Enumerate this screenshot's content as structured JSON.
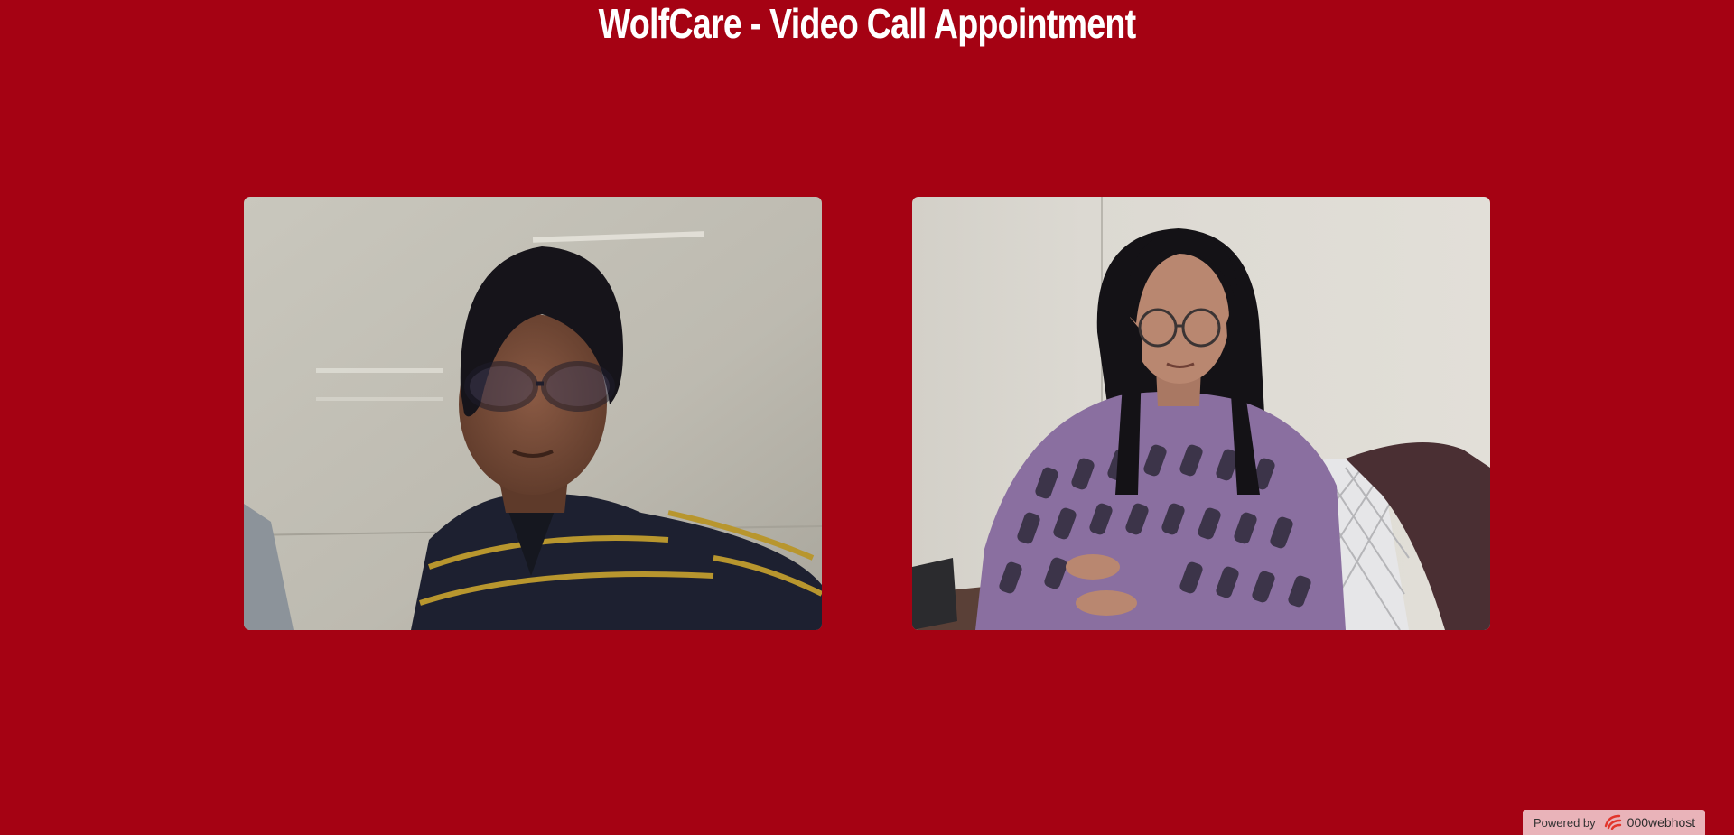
{
  "header": {
    "title": "WolfCare - Video Call Appointment"
  },
  "videos": {
    "local": {
      "name": ""
    },
    "remote": {
      "name": ""
    }
  },
  "footer": {
    "powered_label": "Powered by",
    "brand": "000webhost",
    "brand_icon": "000webhost-logo-icon"
  },
  "colors": {
    "background": "#a50213",
    "title": "#ffffff",
    "badge": "#e9b3b9",
    "brand_accent": "#e2352b"
  }
}
